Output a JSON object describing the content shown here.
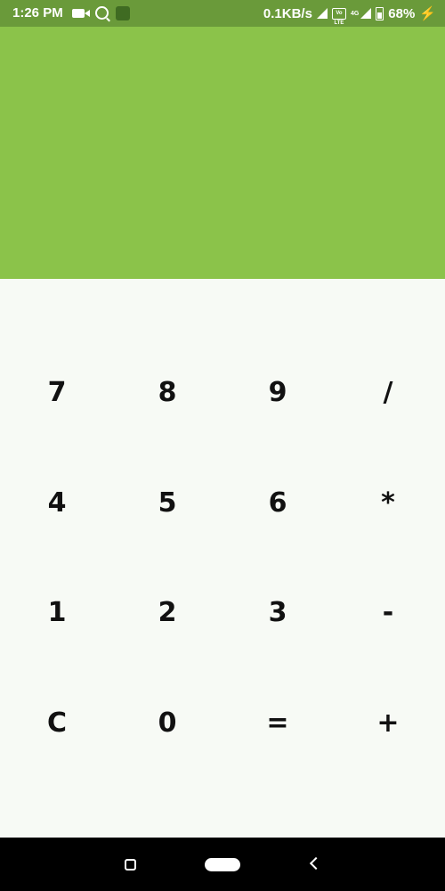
{
  "status_bar": {
    "time": "1:26 PM",
    "network_speed": "0.1KB/s",
    "lte_label": "4G",
    "volte_label": "Vo LTE",
    "battery": "68%",
    "icons": [
      "video-camera-icon",
      "search-icon",
      "app-icon",
      "signal-icon",
      "volte-icon",
      "battery-icon",
      "charging-icon"
    ]
  },
  "display": {
    "value": "",
    "background": "#8bc34a"
  },
  "keypad": {
    "rows": [
      [
        "7",
        "8",
        "9",
        "/"
      ],
      [
        "4",
        "5",
        "6",
        "*"
      ],
      [
        "1",
        "2",
        "3",
        "-"
      ],
      [
        "C",
        "0",
        "=",
        "+"
      ]
    ],
    "background": "#f7faf5"
  },
  "nav_bar": {
    "icons": [
      "recents-icon",
      "home-icon",
      "back-icon"
    ]
  },
  "colors": {
    "status_bar": "#6a9a3a",
    "display": "#8bc34a",
    "keypad": "#f7faf5",
    "nav_bar": "#000000"
  }
}
